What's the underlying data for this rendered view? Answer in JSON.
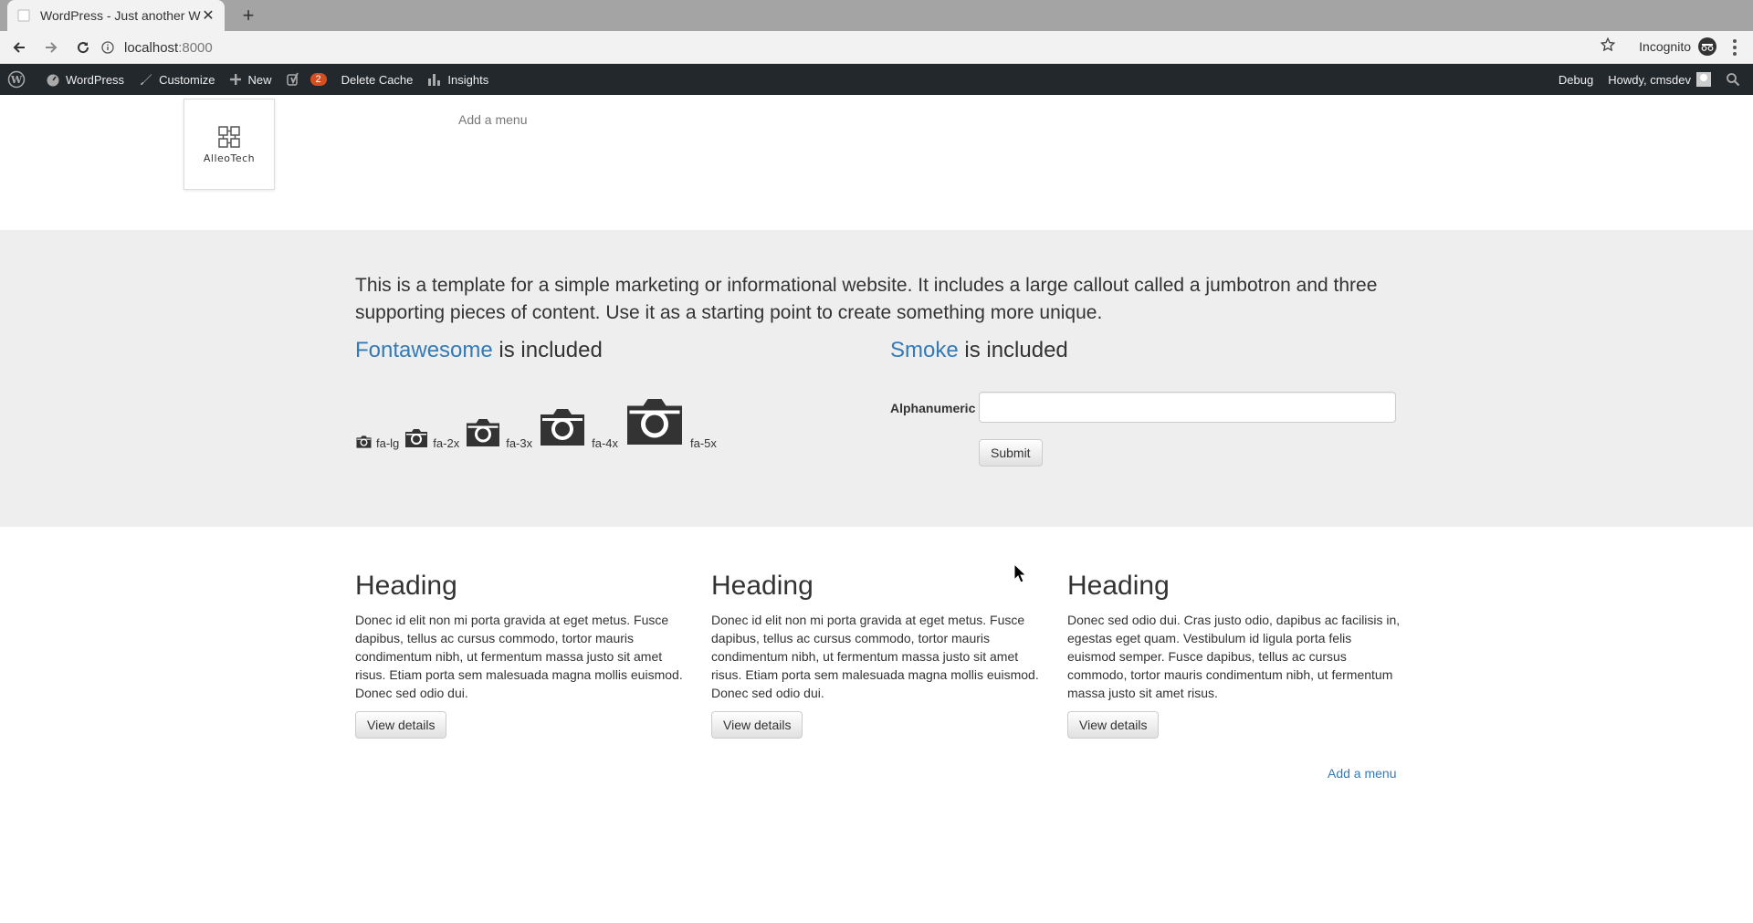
{
  "browser": {
    "tab_title": "WordPress - Just another Wo",
    "url_host": "localhost",
    "url_port": ":8000",
    "incognito_label": "Incognito"
  },
  "admin_bar": {
    "site_name": "WordPress",
    "customize": "Customize",
    "new": "New",
    "yoast_count": "2",
    "delete_cache": "Delete Cache",
    "insights": "Insights",
    "debug": "Debug",
    "howdy": "Howdy, cmsdev"
  },
  "header": {
    "logo_text": "AlleoTech",
    "menu_link": "Add a menu"
  },
  "jumbotron": {
    "lead": "This is a template for a simple marketing or informational website. It includes a large callout called a jumbotron and three supporting pieces of content. Use it as a starting point to create something more unique.",
    "fontawesome": {
      "link": "Fontawesome",
      "suffix": " is included",
      "sizes": [
        "fa-lg",
        "fa-2x",
        "fa-3x",
        "fa-4x",
        "fa-5x"
      ]
    },
    "smoke": {
      "link": "Smoke",
      "suffix": " is included",
      "field_label": "Alphanumeric",
      "field_value": "",
      "submit": "Submit"
    }
  },
  "columns": [
    {
      "heading": "Heading",
      "body": "Donec id elit non mi porta gravida at eget metus. Fusce dapibus, tellus ac cursus commodo, tortor mauris condimentum nibh, ut fermentum massa justo sit amet risus. Etiam porta sem malesuada magna mollis euismod. Donec sed odio dui.",
      "button": "View details"
    },
    {
      "heading": "Heading",
      "body": "Donec id elit non mi porta gravida at eget metus. Fusce dapibus, tellus ac cursus commodo, tortor mauris condimentum nibh, ut fermentum massa justo sit amet risus. Etiam porta sem malesuada magna mollis euismod. Donec sed odio dui.",
      "button": "View details"
    },
    {
      "heading": "Heading",
      "body": "Donec sed odio dui. Cras justo odio, dapibus ac facilisis in, egestas eget quam. Vestibulum id ligula porta felis euismod semper. Fusce dapibus, tellus ac cursus commodo, tortor mauris condimentum nibh, ut fermentum massa justo sit amet risus.",
      "button": "View details"
    }
  ],
  "footer": {
    "menu_link": "Add a menu"
  },
  "colors": {
    "link": "#337ab7",
    "admin_bar": "#23282d",
    "jumbotron_bg": "#eeeeee",
    "badge": "#d54e21"
  }
}
